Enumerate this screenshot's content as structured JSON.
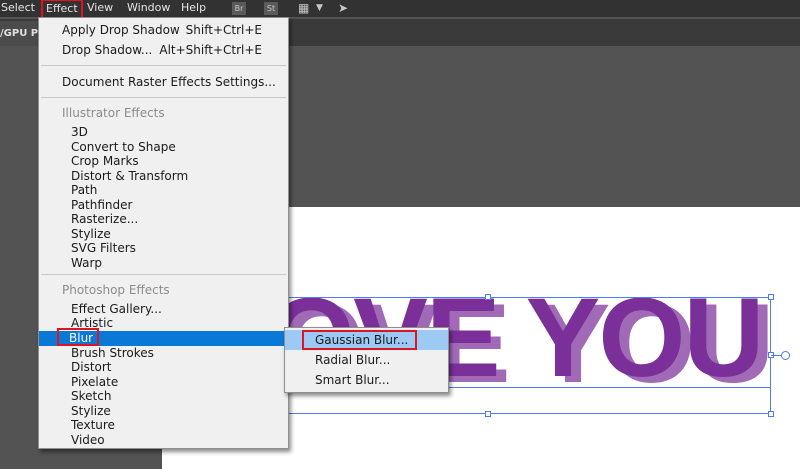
{
  "menubar": {
    "items": [
      "Select",
      "Effect",
      "View",
      "Window",
      "Help"
    ],
    "icons": [
      "Br",
      "St"
    ]
  },
  "tabstrip": {
    "doc_tab_label": "/GPU Pre"
  },
  "artwork": {
    "text": "OVE YOU",
    "main_color": "#7a2f99",
    "shadow_color": "#a06ab7"
  },
  "effect_menu": {
    "apply_label": "Apply Drop Shadow",
    "apply_shortcut": "Shift+Ctrl+E",
    "last_label": "Drop Shadow...",
    "last_shortcut": "Alt+Shift+Ctrl+E",
    "raster_settings": "Document Raster Effects Settings...",
    "illustrator_header": "Illustrator Effects",
    "illustrator_items": [
      "3D",
      "Convert to Shape",
      "Crop Marks",
      "Distort & Transform",
      "Path",
      "Pathfinder",
      "Rasterize...",
      "Stylize",
      "SVG Filters",
      "Warp"
    ],
    "photoshop_header": "Photoshop Effects",
    "photoshop_items": [
      "Effect Gallery...",
      "Artistic",
      "Blur",
      "Brush Strokes",
      "Distort",
      "Pixelate",
      "Sketch",
      "Stylize",
      "Texture",
      "Video"
    ]
  },
  "blur_submenu": {
    "items": [
      "Gaussian Blur...",
      "Radial Blur...",
      "Smart Blur..."
    ]
  },
  "colors": {
    "highlight": "#0a78d7",
    "submenu_highlight": "#9ccaf4",
    "annotation": "#e0141e",
    "selection": "#4c7cf0"
  }
}
